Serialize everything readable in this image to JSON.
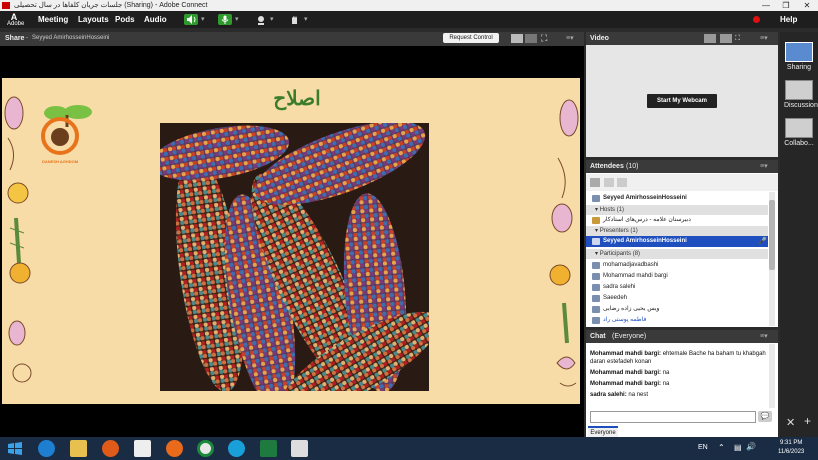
{
  "window": {
    "title": "جلسات جریان کلفا‌ها در سال تحصیلی (Sharing) - Adobe Connect",
    "controls": [
      "—",
      "❐",
      "✕"
    ]
  },
  "menubar": {
    "logo_text": "Adobe",
    "items": [
      "Meeting",
      "Layouts",
      "Pods",
      "Audio"
    ],
    "help": "Help"
  },
  "share_pod": {
    "title": "Share",
    "presenter": "Seyyed AmirhosseinHosseini",
    "request_control": "Request Control",
    "slide_title": "اصلاح",
    "logo_caption": "DANESH AGHDOM"
  },
  "video_pod": {
    "title": "Video",
    "start_webcam": "Start My Webcam"
  },
  "attendees_pod": {
    "title": "Attendees",
    "count": "(10)",
    "current_user": "Seyyed AmirhosseinHosseini",
    "hosts_label": "Hosts (1)",
    "host_name": "دبیرستان علامه - درس‌های استادکار",
    "presenters_label": "Presenters (1)",
    "presenter_name": "Seyyed AmirhosseinHosseini",
    "participants_label": "Participants (8)",
    "participants": [
      "mohamadjavadbashi",
      "Mohammad mahdi bargi",
      "sadra salehi",
      "Saeedeh",
      "ویس یحیی زاده رضایی",
      "فاطمه پوستی راد"
    ]
  },
  "chat_pod": {
    "title": "Chat",
    "scope": "(Everyone)",
    "messages": [
      {
        "sender": "Mohammad mahdi bargi:",
        "text": "ehtemale Bache ha baham tu khabgah daran estefadeh konan"
      },
      {
        "sender": "Mohammad mahdi bargi:",
        "text": "na"
      },
      {
        "sender": "Mohammad mahdi bargi:",
        "text": "na"
      },
      {
        "sender": "sadra salehi:",
        "text": "na nest"
      }
    ],
    "tab": "Everyone"
  },
  "layouts": {
    "items": [
      "Sharing",
      "Discussion",
      "Collabo..."
    ]
  },
  "taskbar": {
    "lang": "EN",
    "time": "9:31 PM",
    "date": "11/6/2023"
  },
  "colors": {
    "slide_bg": "#f7dca8",
    "accent_blue": "#1f4fbf",
    "record_red": "#e01010"
  }
}
